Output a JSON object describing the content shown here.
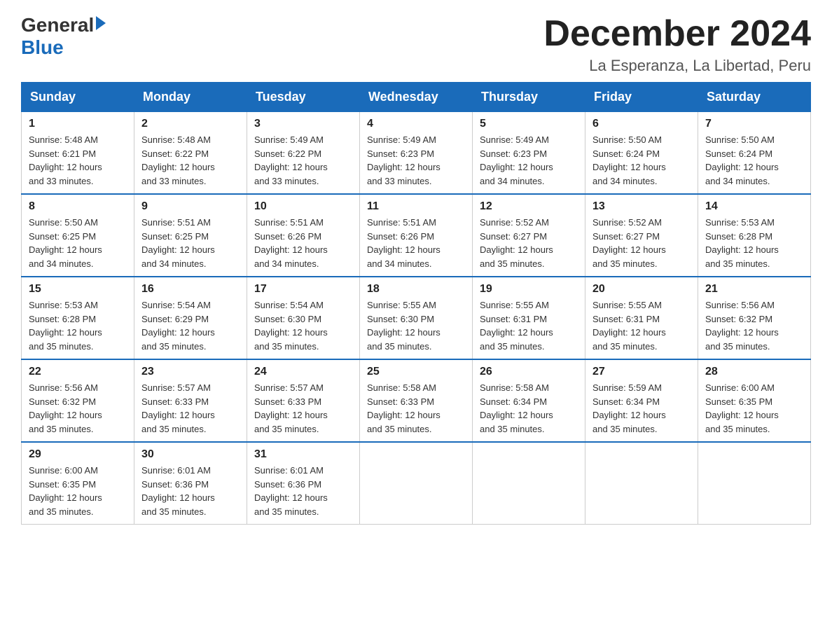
{
  "header": {
    "logo_general": "General",
    "logo_blue": "Blue",
    "calendar_title": "December 2024",
    "calendar_subtitle": "La Esperanza, La Libertad, Peru"
  },
  "days_of_week": [
    "Sunday",
    "Monday",
    "Tuesday",
    "Wednesday",
    "Thursday",
    "Friday",
    "Saturday"
  ],
  "weeks": [
    [
      {
        "day": "1",
        "sunrise": "5:48 AM",
        "sunset": "6:21 PM",
        "daylight": "12 hours and 33 minutes."
      },
      {
        "day": "2",
        "sunrise": "5:48 AM",
        "sunset": "6:22 PM",
        "daylight": "12 hours and 33 minutes."
      },
      {
        "day": "3",
        "sunrise": "5:49 AM",
        "sunset": "6:22 PM",
        "daylight": "12 hours and 33 minutes."
      },
      {
        "day": "4",
        "sunrise": "5:49 AM",
        "sunset": "6:23 PM",
        "daylight": "12 hours and 33 minutes."
      },
      {
        "day": "5",
        "sunrise": "5:49 AM",
        "sunset": "6:23 PM",
        "daylight": "12 hours and 34 minutes."
      },
      {
        "day": "6",
        "sunrise": "5:50 AM",
        "sunset": "6:24 PM",
        "daylight": "12 hours and 34 minutes."
      },
      {
        "day": "7",
        "sunrise": "5:50 AM",
        "sunset": "6:24 PM",
        "daylight": "12 hours and 34 minutes."
      }
    ],
    [
      {
        "day": "8",
        "sunrise": "5:50 AM",
        "sunset": "6:25 PM",
        "daylight": "12 hours and 34 minutes."
      },
      {
        "day": "9",
        "sunrise": "5:51 AM",
        "sunset": "6:25 PM",
        "daylight": "12 hours and 34 minutes."
      },
      {
        "day": "10",
        "sunrise": "5:51 AM",
        "sunset": "6:26 PM",
        "daylight": "12 hours and 34 minutes."
      },
      {
        "day": "11",
        "sunrise": "5:51 AM",
        "sunset": "6:26 PM",
        "daylight": "12 hours and 34 minutes."
      },
      {
        "day": "12",
        "sunrise": "5:52 AM",
        "sunset": "6:27 PM",
        "daylight": "12 hours and 35 minutes."
      },
      {
        "day": "13",
        "sunrise": "5:52 AM",
        "sunset": "6:27 PM",
        "daylight": "12 hours and 35 minutes."
      },
      {
        "day": "14",
        "sunrise": "5:53 AM",
        "sunset": "6:28 PM",
        "daylight": "12 hours and 35 minutes."
      }
    ],
    [
      {
        "day": "15",
        "sunrise": "5:53 AM",
        "sunset": "6:28 PM",
        "daylight": "12 hours and 35 minutes."
      },
      {
        "day": "16",
        "sunrise": "5:54 AM",
        "sunset": "6:29 PM",
        "daylight": "12 hours and 35 minutes."
      },
      {
        "day": "17",
        "sunrise": "5:54 AM",
        "sunset": "6:30 PM",
        "daylight": "12 hours and 35 minutes."
      },
      {
        "day": "18",
        "sunrise": "5:55 AM",
        "sunset": "6:30 PM",
        "daylight": "12 hours and 35 minutes."
      },
      {
        "day": "19",
        "sunrise": "5:55 AM",
        "sunset": "6:31 PM",
        "daylight": "12 hours and 35 minutes."
      },
      {
        "day": "20",
        "sunrise": "5:55 AM",
        "sunset": "6:31 PM",
        "daylight": "12 hours and 35 minutes."
      },
      {
        "day": "21",
        "sunrise": "5:56 AM",
        "sunset": "6:32 PM",
        "daylight": "12 hours and 35 minutes."
      }
    ],
    [
      {
        "day": "22",
        "sunrise": "5:56 AM",
        "sunset": "6:32 PM",
        "daylight": "12 hours and 35 minutes."
      },
      {
        "day": "23",
        "sunrise": "5:57 AM",
        "sunset": "6:33 PM",
        "daylight": "12 hours and 35 minutes."
      },
      {
        "day": "24",
        "sunrise": "5:57 AM",
        "sunset": "6:33 PM",
        "daylight": "12 hours and 35 minutes."
      },
      {
        "day": "25",
        "sunrise": "5:58 AM",
        "sunset": "6:33 PM",
        "daylight": "12 hours and 35 minutes."
      },
      {
        "day": "26",
        "sunrise": "5:58 AM",
        "sunset": "6:34 PM",
        "daylight": "12 hours and 35 minutes."
      },
      {
        "day": "27",
        "sunrise": "5:59 AM",
        "sunset": "6:34 PM",
        "daylight": "12 hours and 35 minutes."
      },
      {
        "day": "28",
        "sunrise": "6:00 AM",
        "sunset": "6:35 PM",
        "daylight": "12 hours and 35 minutes."
      }
    ],
    [
      {
        "day": "29",
        "sunrise": "6:00 AM",
        "sunset": "6:35 PM",
        "daylight": "12 hours and 35 minutes."
      },
      {
        "day": "30",
        "sunrise": "6:01 AM",
        "sunset": "6:36 PM",
        "daylight": "12 hours and 35 minutes."
      },
      {
        "day": "31",
        "sunrise": "6:01 AM",
        "sunset": "6:36 PM",
        "daylight": "12 hours and 35 minutes."
      },
      null,
      null,
      null,
      null
    ]
  ],
  "labels": {
    "sunrise": "Sunrise: ",
    "sunset": "Sunset: ",
    "daylight": "Daylight: "
  },
  "colors": {
    "header_bg": "#1a6bba",
    "border": "#1a6bba"
  }
}
